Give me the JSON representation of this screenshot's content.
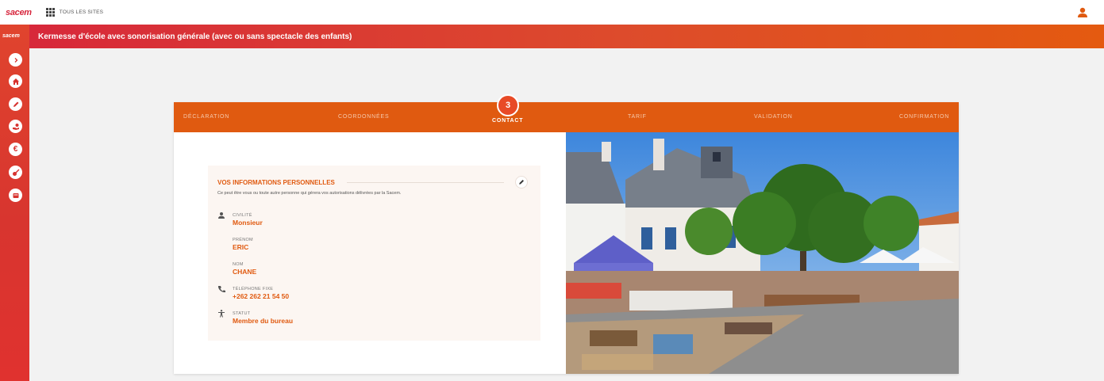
{
  "topbar": {
    "logo": "sacem",
    "all_sites": "TOUS LES SITES"
  },
  "sidebar": {
    "logo": "sacem",
    "items": [
      {
        "icon": "chevron-right-icon"
      },
      {
        "icon": "home-icon"
      },
      {
        "icon": "pencil-icon"
      },
      {
        "icon": "hand-money-icon"
      },
      {
        "icon": "euro-icon"
      },
      {
        "icon": "guitar-icon"
      },
      {
        "icon": "wallet-icon"
      }
    ]
  },
  "header": {
    "title": "Kermesse d'école avec sonorisation générale (avec ou sans spectacle des enfants)"
  },
  "steps": {
    "items": [
      "DÉCLARATION",
      "COORDONNÉES",
      "CONTACT",
      "TARIF",
      "VALIDATION",
      "CONFIRMATION"
    ],
    "active_number": "3"
  },
  "panel": {
    "title": "VOS INFORMATIONS PERSONNELLES",
    "subtitle": "Ce peut être vous ou toute autre personne qui gérera vos autorisations délivrées par la Sacem.",
    "fields": [
      {
        "label": "CIVILITÉ",
        "value": "Monsieur"
      },
      {
        "label": "PRÉNOM",
        "value": "ERIC"
      },
      {
        "label": "NOM",
        "value": "CHANE"
      },
      {
        "label": "TÉLÉPHONE FIXE",
        "value": "+262 262 21 54 50"
      },
      {
        "label": "STATUT",
        "value": "Membre du bureau"
      }
    ]
  },
  "colors": {
    "accent": "#e05a10",
    "brand_red": "#d7283a",
    "panel_bg": "#fcf6f2"
  }
}
